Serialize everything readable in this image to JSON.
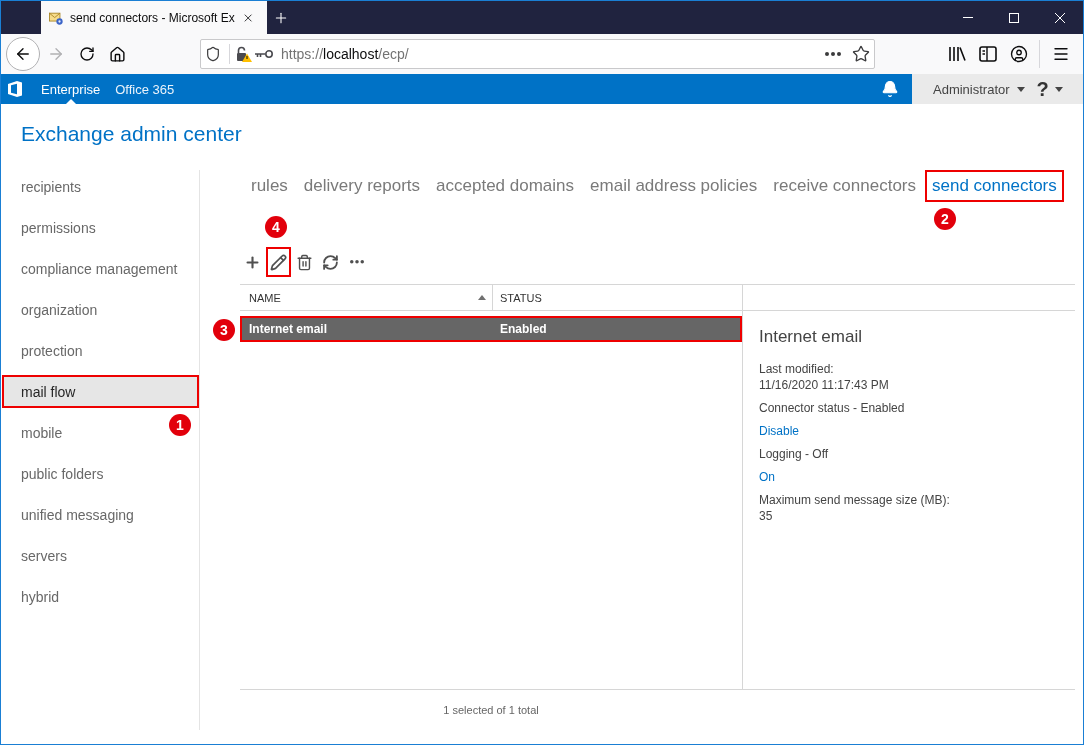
{
  "browser": {
    "tab": {
      "title": "send connectors - Microsoft Ex"
    },
    "url": {
      "scheme": "https://",
      "host": "localhost",
      "path": "/ecp/"
    }
  },
  "app_bar": {
    "tabs": [
      {
        "label": "Enterprise",
        "selected": true
      },
      {
        "label": "Office 365",
        "selected": false
      }
    ],
    "user": "Administrator",
    "help": "?"
  },
  "page_title": "Exchange admin center",
  "sidebar": {
    "items": [
      {
        "label": "recipients",
        "selected": false
      },
      {
        "label": "permissions",
        "selected": false
      },
      {
        "label": "compliance management",
        "selected": false
      },
      {
        "label": "organization",
        "selected": false
      },
      {
        "label": "protection",
        "selected": false
      },
      {
        "label": "mail flow",
        "selected": true,
        "callout": "1"
      },
      {
        "label": "mobile",
        "selected": false
      },
      {
        "label": "public folders",
        "selected": false
      },
      {
        "label": "unified messaging",
        "selected": false
      },
      {
        "label": "servers",
        "selected": false
      },
      {
        "label": "hybrid",
        "selected": false
      }
    ]
  },
  "tabs": [
    {
      "label": "rules",
      "selected": false
    },
    {
      "label": "delivery reports",
      "selected": false
    },
    {
      "label": "accepted domains",
      "selected": false
    },
    {
      "label": "email address policies",
      "selected": false
    },
    {
      "label": "receive connectors",
      "selected": false
    },
    {
      "label": "send connectors",
      "selected": true,
      "callout": "2"
    }
  ],
  "toolbar": {
    "buttons": [
      {
        "kind": "add"
      },
      {
        "kind": "edit",
        "callout": "4"
      },
      {
        "kind": "delete"
      },
      {
        "kind": "refresh"
      },
      {
        "kind": "more"
      }
    ]
  },
  "table": {
    "columns": [
      {
        "label": "NAME",
        "sorted": true
      },
      {
        "label": "STATUS",
        "sorted": false
      }
    ],
    "rows": [
      {
        "cells": [
          "Internet email",
          "Enabled"
        ],
        "selected": true,
        "callout": "3"
      }
    ]
  },
  "details": {
    "title": "Internet email",
    "entries": [
      {
        "kind": "field",
        "label": "Last modified:",
        "value": "11/16/2020 11:17:43 PM"
      },
      {
        "kind": "text",
        "text": "Connector status - Enabled"
      },
      {
        "kind": "link",
        "text": "Disable"
      },
      {
        "kind": "text",
        "text": "Logging - Off"
      },
      {
        "kind": "link",
        "text": "On"
      },
      {
        "kind": "field",
        "label": "Maximum send message size (MB):",
        "value": "35"
      }
    ]
  },
  "status": "1 selected of 1 total"
}
